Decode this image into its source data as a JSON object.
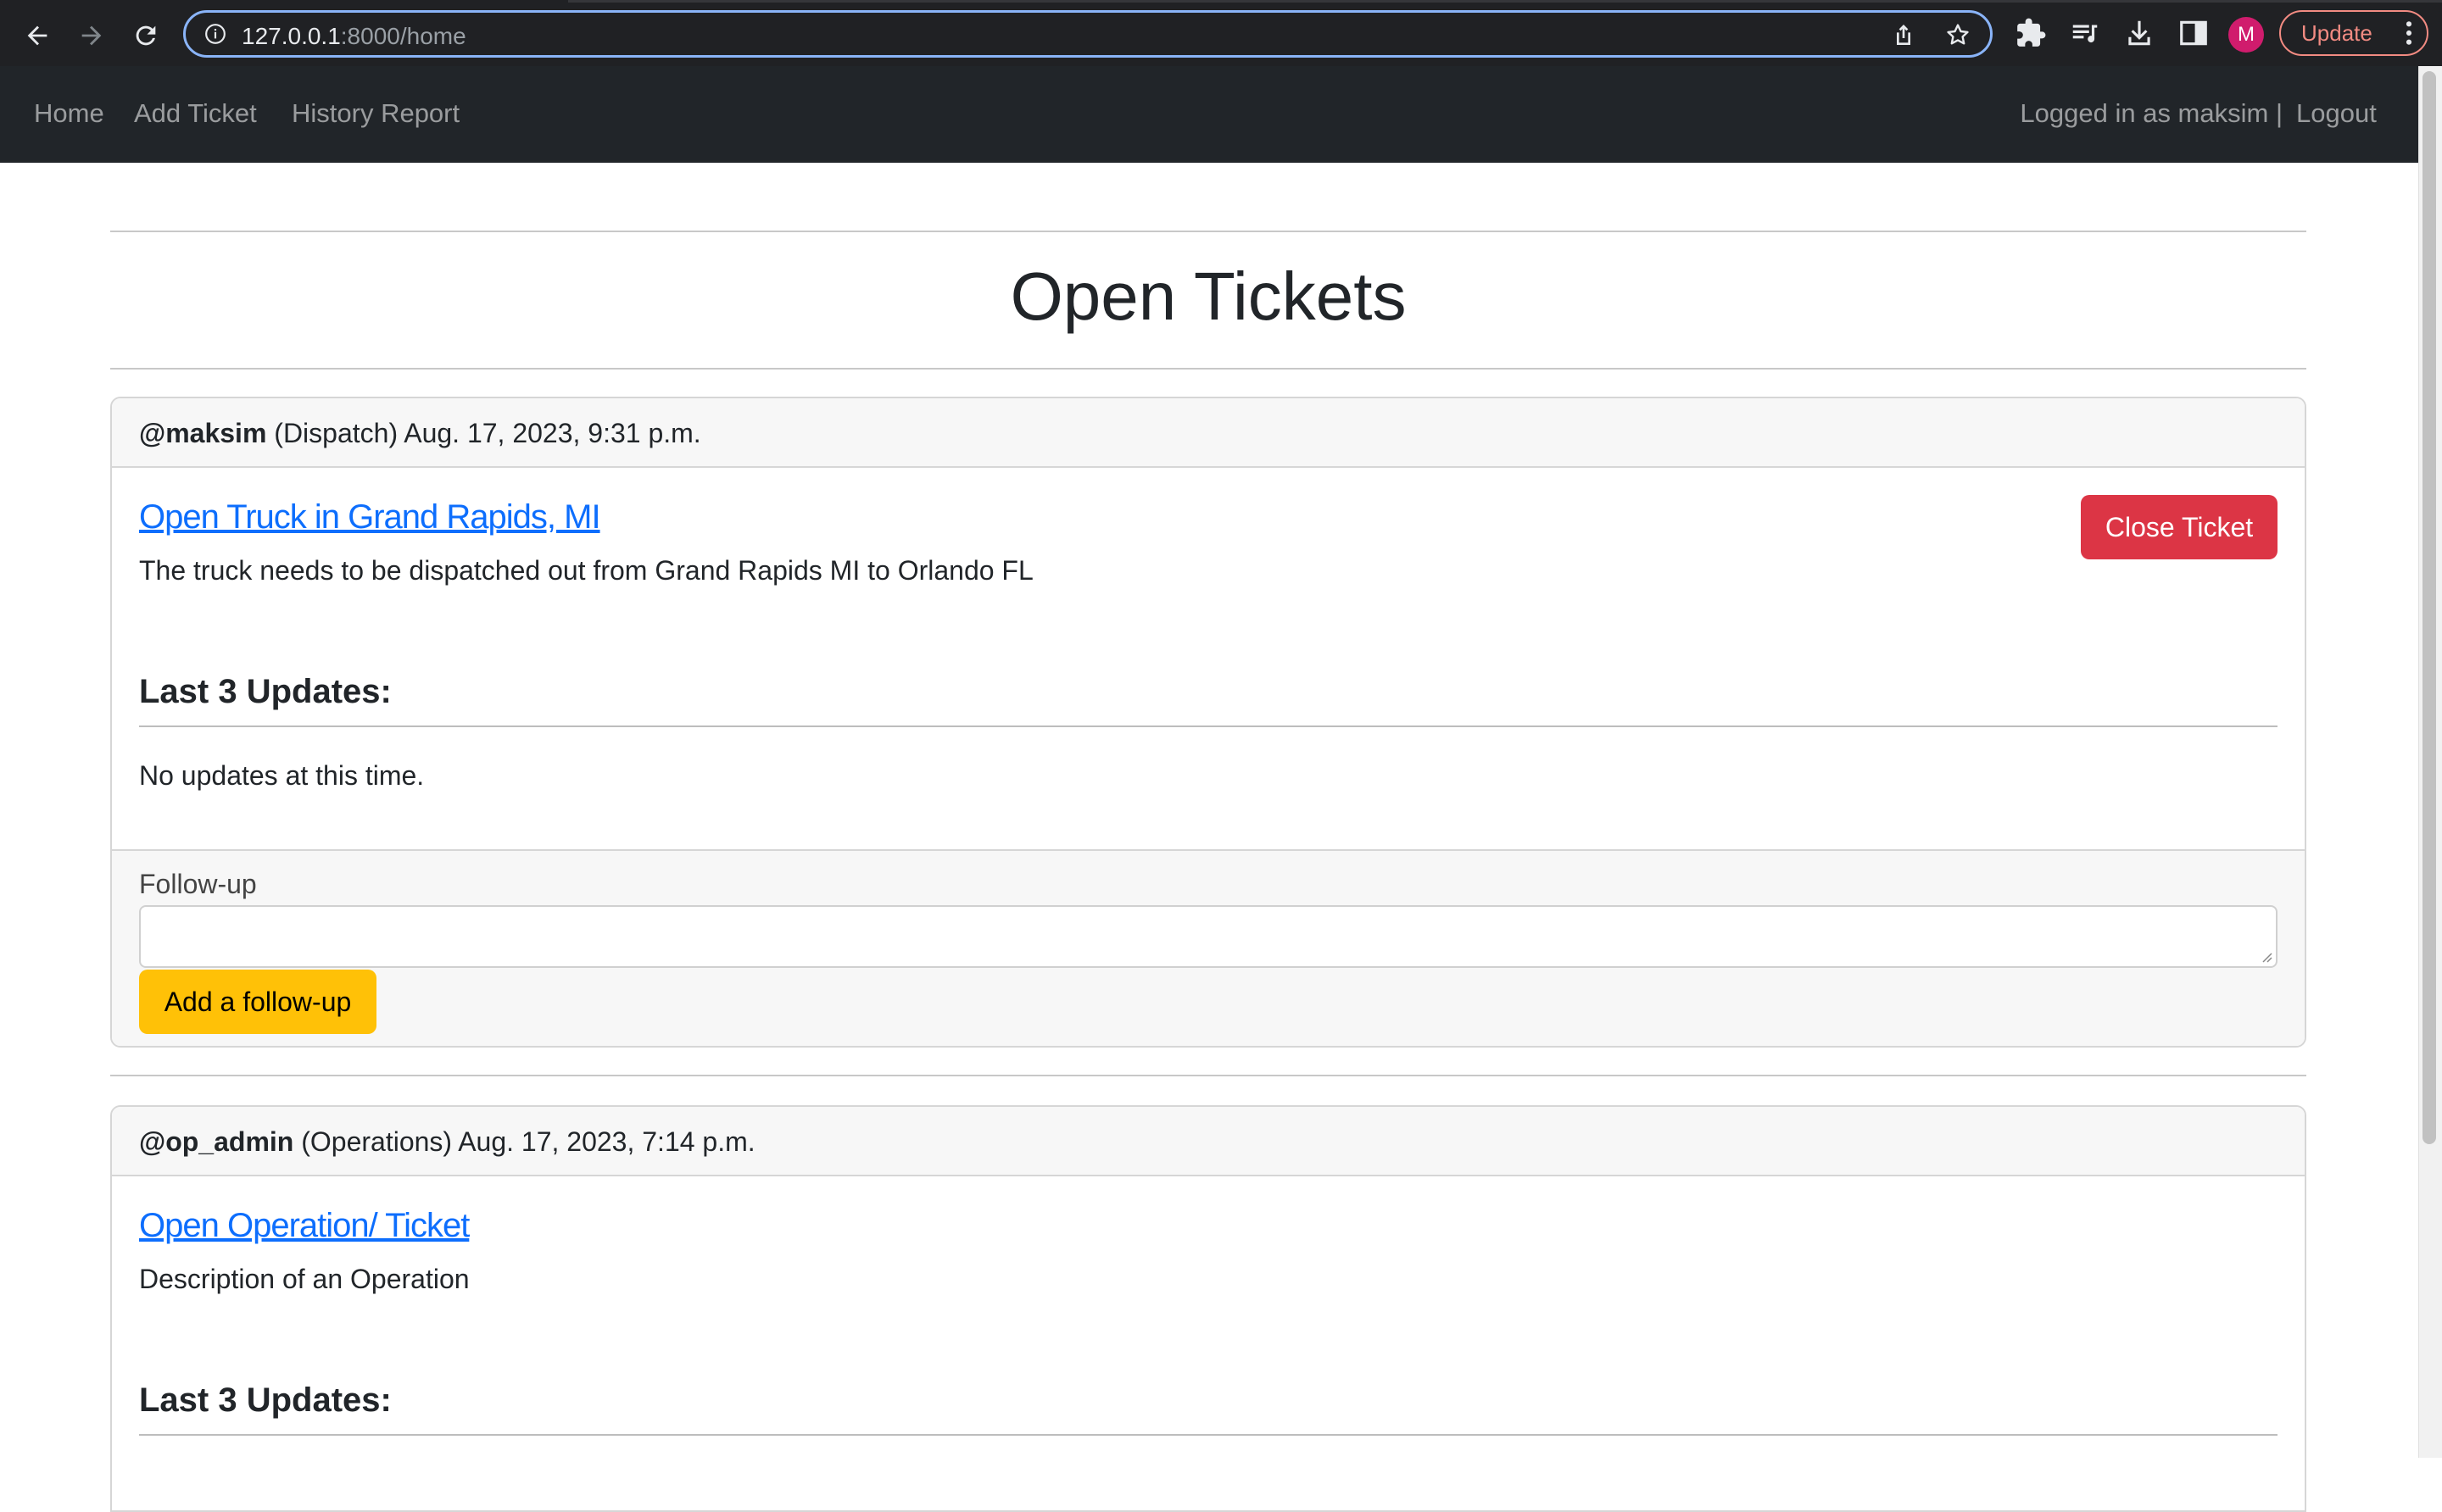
{
  "browser": {
    "url_host": "127.0.0.1",
    "url_rest": ":8000/home",
    "profile_initial": "M",
    "update_label": "Update"
  },
  "navbar": {
    "links": [
      "Home",
      "Add Ticket",
      "History Report"
    ],
    "logged_in": "Logged in as maksim |",
    "logout": "Logout"
  },
  "page": {
    "title": "Open Tickets"
  },
  "tickets": [
    {
      "user": "@maksim",
      "department": "(Dispatch)",
      "timestamp": "Aug. 17, 2023, 9:31 p.m.",
      "title": "Open Truck in Grand Rapids, MI",
      "description": "The truck needs to be dispatched out from Grand Rapids MI to Orlando FL",
      "close_label": "Close Ticket",
      "updates_heading": "Last 3 Updates:",
      "no_updates": "No updates at this time.",
      "followup_label": "Follow-up",
      "followup_button": "Add a follow-up"
    },
    {
      "user": "@op_admin",
      "department": "(Operations)",
      "timestamp": "Aug. 17, 2023, 7:14 p.m.",
      "title": "Open Operation/ Ticket",
      "description": "Description of an Operation",
      "updates_heading": "Last 3 Updates:"
    }
  ]
}
